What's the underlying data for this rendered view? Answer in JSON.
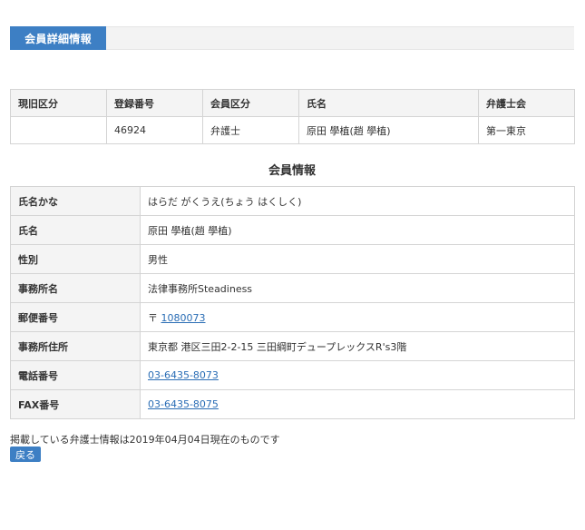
{
  "header": {
    "tab_label": "会員詳細情報"
  },
  "summary": {
    "headers": [
      "現旧区分",
      "登録番号",
      "会員区分",
      "氏名",
      "弁護士会"
    ],
    "values": [
      "",
      "46924",
      "弁護士",
      "原田 學植(趙 學植)",
      "第一東京"
    ]
  },
  "section_title": "会員情報",
  "info_rows": [
    {
      "label": "氏名かな",
      "value": "はらだ がくうえ(ちょう はくしく)"
    },
    {
      "label": "氏名",
      "value": "原田 學植(趙 學植)"
    },
    {
      "label": "性別",
      "value": "男性"
    },
    {
      "label": "事務所名",
      "value": "法律事務所Steadiness"
    },
    {
      "label": "郵便番号",
      "prefix": "〒",
      "value": "1080073"
    },
    {
      "label": "事務所住所",
      "value": "東京都 港区三田2-2-15 三田綱町デュープレックスR's3階"
    },
    {
      "label": "電話番号",
      "value": "03-6435-8073"
    },
    {
      "label": "FAX番号",
      "value": "03-6435-8075"
    }
  ],
  "footnote": "掲載している弁護士情報は2019年04月04日現在のものです",
  "back_button_label": "戻る",
  "colors": {
    "accent": "#3d7fc4",
    "link": "#2a6db5",
    "header_bg": "#f4f4f4",
    "border": "#d4d4d4"
  }
}
